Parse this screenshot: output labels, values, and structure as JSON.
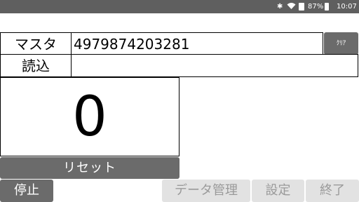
{
  "status_bar": {
    "bluetooth_icon": "bluetooth-icon",
    "wifi_icon": "wifi-icon",
    "sim_icon": "sim-icon",
    "battery_percent": "87%",
    "battery_icon": "battery-icon",
    "time": "10:07"
  },
  "form": {
    "master_label": "マスタ",
    "master_value": "4979874203281",
    "read_label": "読込",
    "read_value": "",
    "clear_label": "ｸﾘｱ"
  },
  "counter": {
    "value": "0"
  },
  "buttons": {
    "reset": "リセット",
    "stop": "停止",
    "data_manage": "データ管理",
    "settings": "設定",
    "exit": "終了"
  },
  "colors": {
    "status_bar": "#5f5f5f",
    "active_button": "#6b6b6b",
    "disabled_button": "#e2e2e2",
    "disabled_text": "#9a9a9a"
  }
}
